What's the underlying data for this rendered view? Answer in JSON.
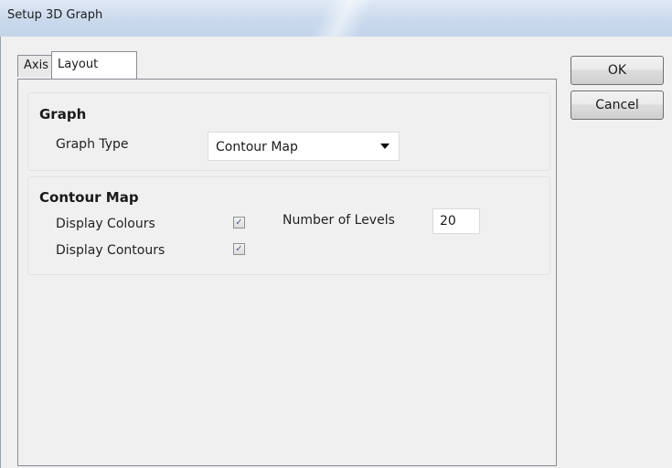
{
  "window": {
    "title": "Setup 3D Graph"
  },
  "tabs": [
    {
      "label": "Axis",
      "active": false
    },
    {
      "label": "Layout",
      "active": true
    }
  ],
  "graph_group": {
    "title": "Graph",
    "graph_type_label": "Graph Type",
    "graph_type_value": "Contour Map"
  },
  "contour_group": {
    "title": "Contour Map",
    "display_colours_label": "Display Colours",
    "display_colours_checked": true,
    "display_contours_label": "Display Contours",
    "display_contours_checked": true,
    "levels_label": "Number of Levels",
    "levels_value": "20"
  },
  "buttons": {
    "ok": "OK",
    "cancel": "Cancel"
  },
  "icons": {
    "check": "✓"
  }
}
